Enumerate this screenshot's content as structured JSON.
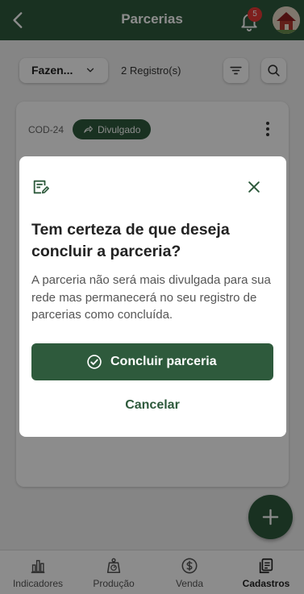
{
  "header": {
    "title": "Parcerias",
    "notification_count": "5"
  },
  "toolbar": {
    "filter_value": "Fazen...",
    "records_count": "2 Registro(s)"
  },
  "card": {
    "code": "COD-24",
    "status_chip": "Divulgado"
  },
  "bottom_nav": [
    {
      "label": "Indicadores",
      "icon": "bar-chart-icon",
      "active": false
    },
    {
      "label": "Produção",
      "icon": "scale-icon",
      "active": false
    },
    {
      "label": "Venda",
      "icon": "dollar-circle-icon",
      "active": false
    },
    {
      "label": "Cadastros",
      "icon": "documents-icon",
      "active": true
    }
  ],
  "modal": {
    "title": "Tem certeza de que deseja concluir a parceria?",
    "body": "A parceria não será mais divulgada para sua rede mas permanecerá no seu registro de parcerias como concluída.",
    "confirm_label": "Concluir parceria",
    "cancel_label": "Cancelar"
  },
  "colors": {
    "primary": "#2e5a3c",
    "badge": "#e53935",
    "overlay": "rgba(0,0,0,0.45)"
  }
}
